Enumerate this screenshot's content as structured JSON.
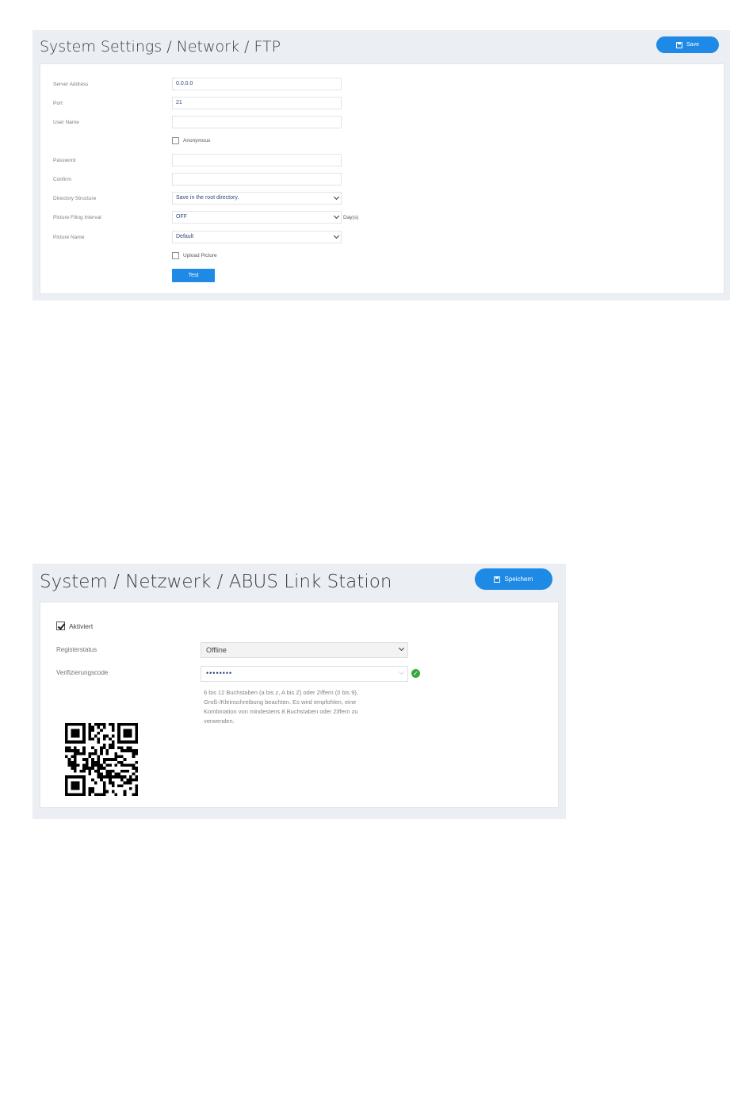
{
  "ftp": {
    "breadcrumb": "System Settings / Network / FTP",
    "save_label": "Save",
    "fields": {
      "server_address_label": "Server Address",
      "server_address_value": "0.0.0.0",
      "port_label": "Port",
      "port_value": "21",
      "user_name_label": "User Name",
      "user_name_value": "",
      "anonymous_label": "Anonymous",
      "password_label": "Password",
      "password_value": "",
      "confirm_label": "Confirm",
      "confirm_value": "",
      "directory_structure_label": "Directory Structure",
      "directory_structure_value": "Save in the root directory.",
      "picture_filing_interval_label": "Picture Filing Interval",
      "picture_filing_interval_value": "OFF",
      "picture_filing_interval_unit": "Day(s)",
      "picture_name_label": "Picture Name",
      "picture_name_value": "Default",
      "upload_picture_label": "Upload Picture"
    },
    "test_label": "Test"
  },
  "abus": {
    "breadcrumb": "System / Netzwerk / ABUS Link Station",
    "save_label": "Speichern",
    "activated_label": "Aktiviert",
    "register_status_label": "Registerstatus",
    "register_status_value": "Offline",
    "verification_code_label": "Verifizierungscode",
    "verification_code_value": "••••••••",
    "hint_text": "6 bis 12 Buchstaben (a bis z, A bis Z) oder Ziffern (0 bis 9), Groß-/Kleinschreibung beachten. Es wird empfohlen, eine Kombination von mindestens 8 Buchstaben oder Ziffern zu verwenden."
  },
  "colors": {
    "accent": "#1f8ae6",
    "panel_bg": "#ebeef3",
    "ok": "#36a83f"
  },
  "icons": [
    "save-icon",
    "chevron-down-icon",
    "check-circle-icon",
    "qr-code-icon"
  ]
}
